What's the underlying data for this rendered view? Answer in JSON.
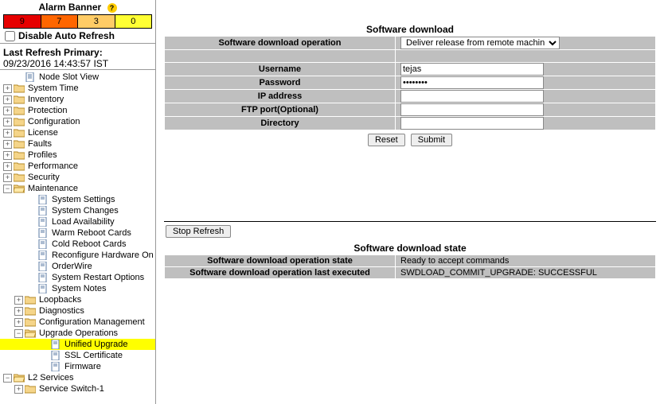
{
  "alarm": {
    "title": "Alarm Banner",
    "cells": [
      "9",
      "7",
      "3",
      "0"
    ],
    "disable_label": "Disable Auto Refresh",
    "last_refresh_label": "Last Refresh Primary:",
    "last_refresh_value": "09/23/2016 14:43:57 IST"
  },
  "tree": {
    "node_slot": "Node Slot View",
    "system_time": "System Time",
    "inventory": "Inventory",
    "protection": "Protection",
    "configuration": "Configuration",
    "license": "License",
    "faults": "Faults",
    "profiles": "Profiles",
    "performance": "Performance",
    "security": "Security",
    "maintenance": "Maintenance",
    "system_settings": "System Settings",
    "system_changes": "System Changes",
    "load_availability": "Load Availability",
    "warm_reboot": "Warm Reboot Cards",
    "cold_reboot": "Cold Reboot Cards",
    "reconfigure": "Reconfigure Hardware On Card",
    "orderwire": "OrderWire",
    "system_restart": "System Restart Options",
    "system_notes": "System Notes",
    "loopbacks": "Loopbacks",
    "diagnostics": "Diagnostics",
    "config_mgmt": "Configuration Management",
    "upgrade_ops": "Upgrade Operations",
    "unified_upgrade": "Unified Upgrade",
    "ssl_cert": "SSL Certificate",
    "firmware": "Firmware",
    "l2_services": "L2 Services",
    "service_switch": "Service Switch-1"
  },
  "form": {
    "title": "Software download",
    "op_label": "Software download operation",
    "op_value": "Deliver release from remote machine",
    "username_label": "Username",
    "username_value": "tejas",
    "password_label": "Password",
    "password_value": "••••••••",
    "ip_label": "IP address",
    "ftp_label": "FTP port(Optional)",
    "dir_label": "Directory",
    "reset": "Reset",
    "submit": "Submit"
  },
  "state": {
    "stop_refresh": "Stop Refresh",
    "title": "Software download state",
    "row1_label": "Software download operation state",
    "row1_value": "Ready to accept commands",
    "row2_label": "Software download operation last executed",
    "row2_value": "SWDLOAD_COMMIT_UPGRADE: SUCCESSFUL"
  }
}
